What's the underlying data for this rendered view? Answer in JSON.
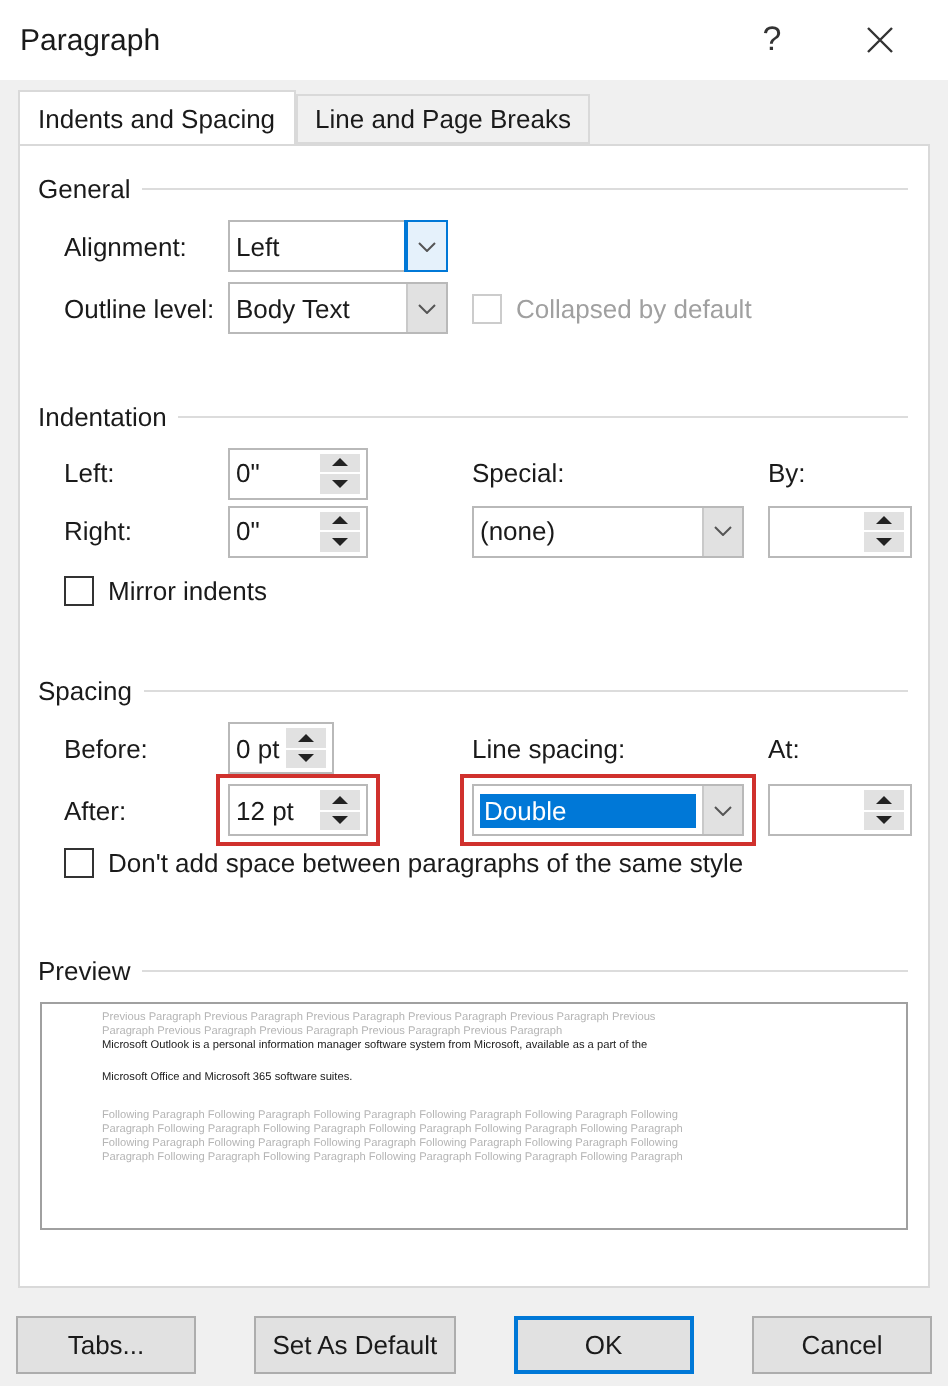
{
  "window": {
    "title": "Paragraph",
    "help": "?"
  },
  "tabs": [
    {
      "label": "Indents and Spacing",
      "selected": true
    },
    {
      "label": "Line and Page Breaks",
      "selected": false
    }
  ],
  "general": {
    "title": "General",
    "alignment": {
      "label": "Alignment:",
      "value": "Left",
      "focused": true
    },
    "outline_level": {
      "label": "Outline level:",
      "value": "Body Text",
      "focused": false
    },
    "collapsed": {
      "label": "Collapsed by default",
      "checked": false,
      "disabled": true
    }
  },
  "indentation": {
    "title": "Indentation",
    "left": {
      "label": "Left:",
      "value": "0\""
    },
    "right": {
      "label": "Right:",
      "value": "0\""
    },
    "special": {
      "label": "Special:",
      "value": "(none)",
      "focused": false
    },
    "by": {
      "label": "By:"
    },
    "mirror": {
      "label": "Mirror indents",
      "checked": false,
      "disabled": false
    }
  },
  "spacing": {
    "title": "Spacing",
    "before": {
      "label": "Before:",
      "value": "0 pt",
      "highlighted": false
    },
    "after": {
      "label": "After:",
      "value": "12 pt",
      "highlighted": true
    },
    "line_spacing": {
      "label": "Line spacing:",
      "value": "Double",
      "selected": true,
      "highlighted": true,
      "focused": false
    },
    "at": {
      "label": "At:"
    },
    "dont_add": {
      "label": "Don't add space between paragraphs of the same style",
      "checked": false,
      "disabled": false
    }
  },
  "preview": {
    "title": "Preview",
    "previous_lines": [
      "Previous Paragraph Previous Paragraph Previous Paragraph Previous Paragraph Previous Paragraph Previous",
      "Paragraph Previous Paragraph Previous Paragraph Previous Paragraph Previous Paragraph"
    ],
    "text_lines": [
      "Microsoft Outlook is a personal information manager software system from Microsoft, available as a part of the",
      "Microsoft Office and Microsoft 365 software suites."
    ],
    "following_lines": [
      "Following Paragraph Following Paragraph Following Paragraph Following Paragraph Following Paragraph Following",
      "Paragraph Following Paragraph Following Paragraph Following Paragraph Following Paragraph Following Paragraph",
      "Following Paragraph Following Paragraph Following Paragraph Following Paragraph Following Paragraph Following",
      "Paragraph Following Paragraph Following Paragraph Following Paragraph Following Paragraph Following Paragraph"
    ]
  },
  "buttons": [
    {
      "label": "Tabs...",
      "default": false
    },
    {
      "label": "Set As Default",
      "default": false
    },
    {
      "label": "OK",
      "default": true
    },
    {
      "label": "Cancel",
      "default": false
    }
  ]
}
